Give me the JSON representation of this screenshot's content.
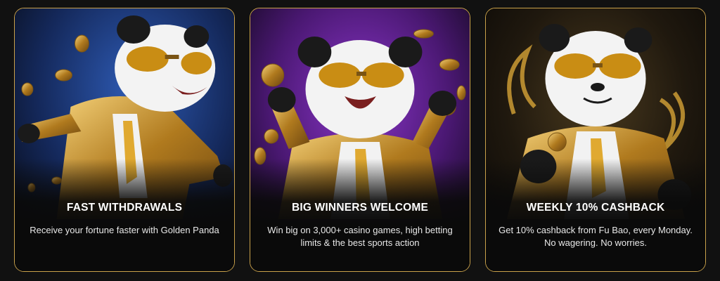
{
  "cards": [
    {
      "title": "FAST WITHDRAWALS",
      "description": "Receive your fortune faster with Golden Panda",
      "illustration": "panda-running-icon",
      "background_color": "#1d3a78"
    },
    {
      "title": "BIG WINNERS WELCOME",
      "description": "Win big on 3,000+ casino games, high betting limits & the best sports action",
      "illustration": "panda-celebrating-icon",
      "background_color": "#5a1f86"
    },
    {
      "title": "WEEKLY 10% CASHBACK",
      "description": "Get 10% cashback from Fu Bao, every Monday. No wagering. No worries.",
      "illustration": "panda-holding-coin-icon",
      "background_color": "#2a2418"
    }
  ],
  "colors": {
    "card_border": "#c9a14a",
    "gold": "#d9a43a",
    "page_background": "#111111"
  }
}
